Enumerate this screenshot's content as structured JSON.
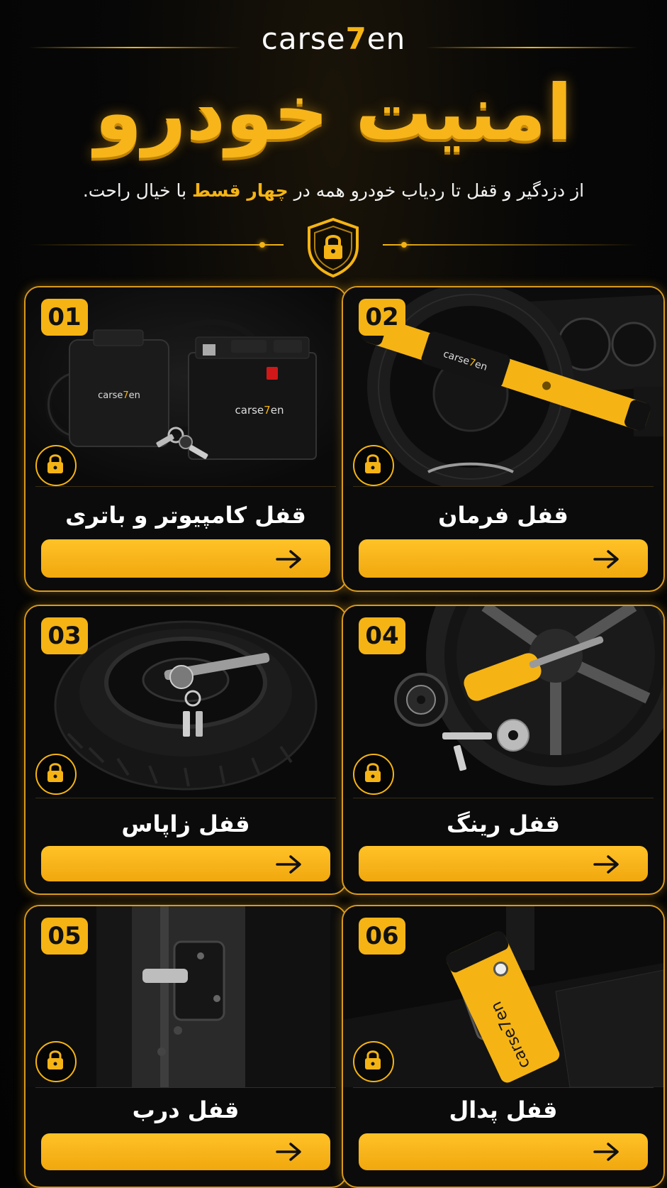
{
  "brand": {
    "logo_left": "carse",
    "logo_seven": "7",
    "logo_right": "en"
  },
  "header": {
    "title": "امنیت خودرو",
    "subtitle_before": "از دزدگیر و قفل تا ردیاب خودرو همه در ",
    "subtitle_highlight": "چهار قسط",
    "subtitle_after": " با خیال راحت."
  },
  "cards": [
    {
      "number": "01",
      "title": "قفل کامپیوتر و باتری",
      "image_icon": "computer-battery-lock-image"
    },
    {
      "number": "02",
      "title": "قفل فرمان",
      "image_icon": "steering-wheel-lock-image"
    },
    {
      "number": "03",
      "title": "قفل زاپاس",
      "image_icon": "spare-tire-lock-image"
    },
    {
      "number": "04",
      "title": "قفل رینگ",
      "image_icon": "wheel-rim-lock-image"
    },
    {
      "number": "05",
      "title": "قفل درب",
      "image_icon": "door-lock-image"
    },
    {
      "number": "06",
      "title": "قفل پدال",
      "image_icon": "pedal-lock-image"
    }
  ],
  "colors": {
    "accent": "#f5b414",
    "background": "#050505",
    "card_border": "#d99a1c"
  }
}
